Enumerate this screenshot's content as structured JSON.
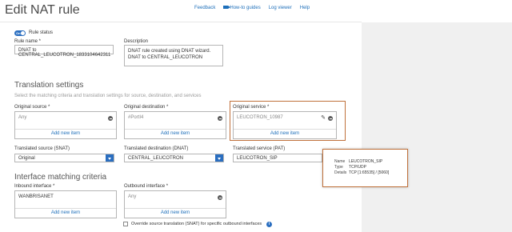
{
  "header": {
    "title": "Edit NAT rule",
    "links": {
      "feedback": "Feedback",
      "how_to": "How-to guides",
      "log_viewer": "Log viewer",
      "help": "Help"
    }
  },
  "rule": {
    "status_toggle": "On",
    "status_label": "Rule status",
    "name_label": "Rule name *",
    "name_value": "DNAT to CENTRAL_LEUCOTRON_1833104642311",
    "description_label": "Description",
    "description_value": "DNAT rule created using DNAT wizard. DNAT to CENTRAL_LEUCOTRON"
  },
  "translation": {
    "title": "Translation settings",
    "subtitle": "Select the matching criteria and translation settings for source, destination, and services",
    "original_source": {
      "label": "Original source *",
      "value": "Any",
      "add": "Add new item"
    },
    "original_destination": {
      "label": "Original destination *",
      "value": "#PortI4",
      "add": "Add new item"
    },
    "original_service": {
      "label": "Original service *",
      "value": "LEUCOTRON_10987",
      "add": "Add new item"
    },
    "translated_source": {
      "label": "Translated source (SNAT)",
      "value": "Original"
    },
    "translated_destination": {
      "label": "Translated destination (DNAT)",
      "value": "CENTRAL_LEUCOTRON"
    },
    "translated_service": {
      "label": "Translated service (PAT)",
      "value": "LEUCOTRON_SIP"
    }
  },
  "tooltip": {
    "name_k": "Name",
    "name_v": "LEUCOTRON_SIP",
    "type_k": "Type",
    "type_v": "TCP/UDP",
    "details_k": "Details",
    "details_v": "TCP [1:65535] / [5060]"
  },
  "interface": {
    "title": "Interface matching criteria",
    "inbound": {
      "label": "Inbound interface *",
      "value": "WANBRISANET",
      "add": "Add new item"
    },
    "outbound": {
      "label": "Outbound interface *",
      "value": "Any",
      "add": "Add new item"
    },
    "override_label": "Override source translation (SNAT) for specific outbound interfaces"
  },
  "colors": {
    "accent": "#2a6ec0",
    "highlight": "#c0703a",
    "link": "#1e6fba"
  }
}
